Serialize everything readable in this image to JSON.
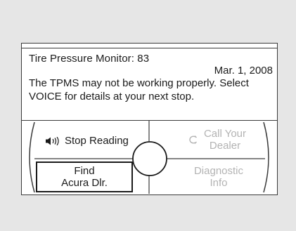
{
  "message": {
    "title": "Tire Pressure Monitor:  83",
    "date": "Mar. 1, 2008",
    "body": "The TPMS may not be working properly. Select VOICE for details at your next stop."
  },
  "buttons": {
    "stop_reading": "Stop Reading",
    "call_line1": "Call Your",
    "call_line2": "Dealer",
    "find_line1": "Find",
    "find_line2": "Acura Dlr.",
    "diag_line1": "Diagnostic",
    "diag_line2": "Info"
  },
  "icons": {
    "stop_reading": "speaker-icon",
    "call": "phone-icon"
  },
  "colors": {
    "background": "#e6e6e6",
    "screen": "#ffffff",
    "text": "#1a1a1a",
    "disabled": "#b3b3b3",
    "border": "#3a3a3a"
  }
}
